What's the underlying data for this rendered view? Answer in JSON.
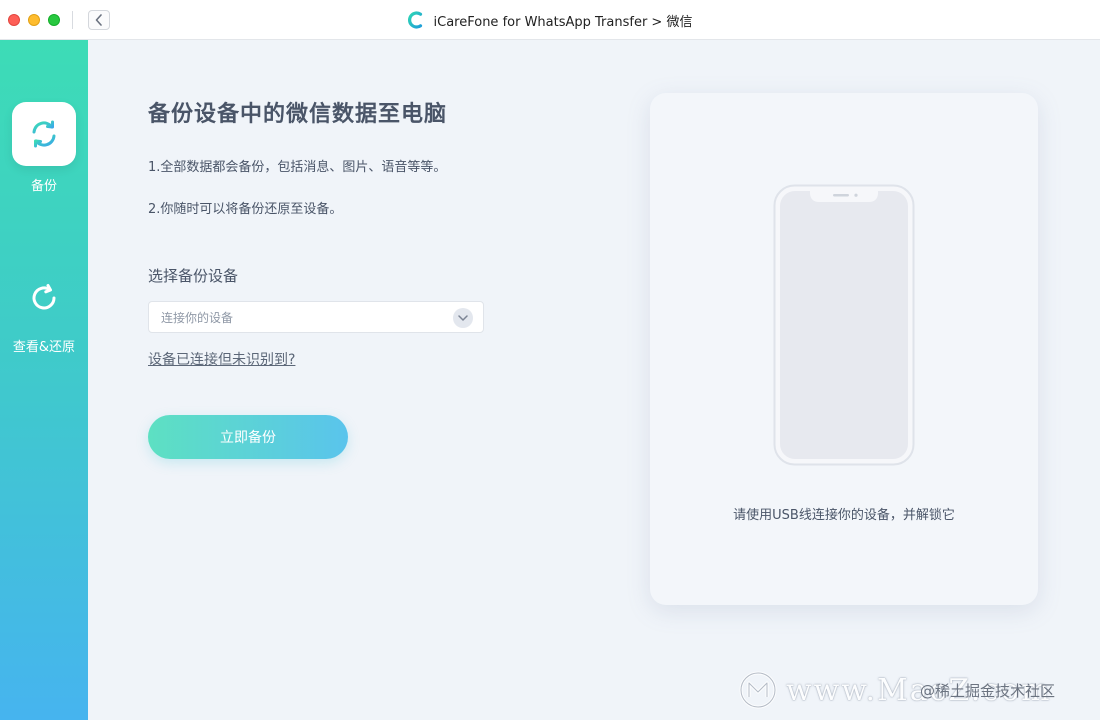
{
  "window": {
    "title": "iCareFone for WhatsApp Transfer > 微信"
  },
  "sidebar": {
    "items": [
      {
        "label": "备份",
        "icon": "sync-icon",
        "active": true
      },
      {
        "label": "查看&还原",
        "icon": "restore-icon",
        "active": false
      }
    ]
  },
  "main": {
    "title": "备份设备中的微信数据至电脑",
    "info": [
      "1.全部数据都会备份，包括消息、图片、语音等等。",
      "2.你随时可以将备份还原至设备。"
    ],
    "select_label": "选择备份设备",
    "device_select": {
      "placeholder": "连接你的设备"
    },
    "help_link": "设备已连接但未识别到?",
    "backup_button": "立即备份"
  },
  "device_card": {
    "hint": "请使用USB线连接你的设备，并解锁它"
  },
  "watermark": {
    "text": "www.MacZ.com",
    "cn_text": "@稀土掘金技术社区"
  },
  "colors": {
    "accent_start": "#3ddcb6",
    "accent_end": "#46b4ef",
    "background": "#f0f4f9"
  }
}
